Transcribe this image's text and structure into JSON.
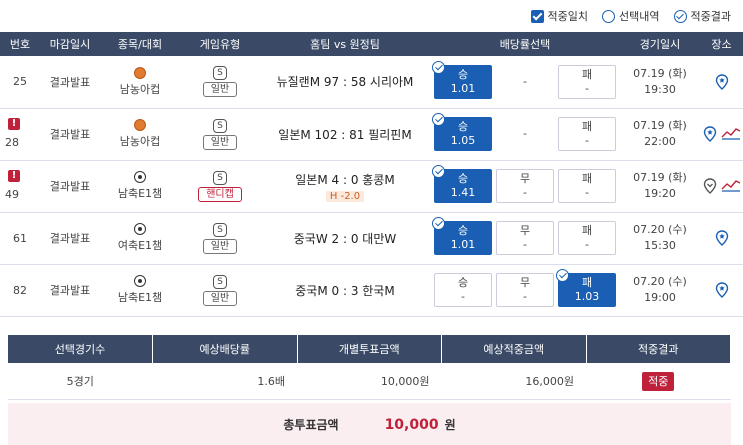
{
  "legend": [
    {
      "label": "적중일치",
      "style": "check"
    },
    {
      "label": "선택내역",
      "style": "circle-empty"
    },
    {
      "label": "적중결과",
      "style": "circle-check"
    }
  ],
  "columns": [
    "번호",
    "마감일시",
    "종목/대회",
    "게임유형",
    "홈팀 vs 원정팀",
    "배당률선택",
    "경기일시",
    "장소"
  ],
  "games": [
    {
      "no": "25",
      "warn": false,
      "close": "결과발표",
      "sport": "basket",
      "league": "남농아컵",
      "type": "일반",
      "handi": false,
      "match": "뉴질랜M 97 : 58 시리아M",
      "handi_value": "",
      "odds": [
        {
          "label": "승",
          "value": "1.01",
          "sel": true
        },
        {
          "label": "-",
          "value": "",
          "sel": false,
          "blank": true
        },
        {
          "label": "패",
          "value": "-",
          "sel": false
        }
      ],
      "date": "07.19 (화)",
      "time": "19:30",
      "chart": false
    },
    {
      "no": "28",
      "warn": true,
      "close": "결과발표",
      "sport": "basket",
      "league": "남농아컵",
      "type": "일반",
      "handi": false,
      "match": "일본M 102 : 81 필리핀M",
      "handi_value": "",
      "odds": [
        {
          "label": "승",
          "value": "1.05",
          "sel": true
        },
        {
          "label": "-",
          "value": "",
          "sel": false,
          "blank": true
        },
        {
          "label": "패",
          "value": "-",
          "sel": false
        }
      ],
      "date": "07.19 (화)",
      "time": "22:00",
      "chart": true
    },
    {
      "no": "49",
      "warn": true,
      "close": "결과발표",
      "sport": "soccer",
      "league": "남축E1챔",
      "type": "핸디캡",
      "handi": true,
      "match": "일본M 4 : 0 홍콩M",
      "handi_value": "H -2.0",
      "odds": [
        {
          "label": "승",
          "value": "1.41",
          "sel": true
        },
        {
          "label": "무",
          "value": "-",
          "sel": false
        },
        {
          "label": "패",
          "value": "-",
          "sel": false
        }
      ],
      "date": "07.19 (화)",
      "time": "19:20",
      "chart": true
    },
    {
      "no": "61",
      "warn": false,
      "close": "결과발표",
      "sport": "soccer",
      "league": "여축E1챔",
      "type": "일반",
      "handi": false,
      "match": "중국W 2 : 0 대만W",
      "handi_value": "",
      "odds": [
        {
          "label": "승",
          "value": "1.01",
          "sel": true
        },
        {
          "label": "무",
          "value": "-",
          "sel": false
        },
        {
          "label": "패",
          "value": "-",
          "sel": false
        }
      ],
      "date": "07.20 (수)",
      "time": "15:30",
      "chart": false
    },
    {
      "no": "82",
      "warn": false,
      "close": "결과발표",
      "sport": "soccer",
      "league": "남축E1챔",
      "type": "일반",
      "handi": false,
      "match": "중국M 0 : 3 한국M",
      "handi_value": "",
      "odds": [
        {
          "label": "승",
          "value": "-",
          "sel": false
        },
        {
          "label": "무",
          "value": "-",
          "sel": false
        },
        {
          "label": "패",
          "value": "1.03",
          "sel": true
        }
      ],
      "date": "07.20 (수)",
      "time": "19:00",
      "chart": false
    }
  ],
  "summary": {
    "headers": [
      "선택경기수",
      "예상배당률",
      "개별투표금액",
      "예상적중금액",
      "적중결과"
    ],
    "count": "5경기",
    "odds": "1.6배",
    "stake": "10,000원",
    "expected": "16,000원",
    "result": "적중"
  },
  "total": {
    "label": "총투표금액",
    "amount": "10,000",
    "unit": "원"
  },
  "colors": {
    "header_bg": "#3a4a66",
    "selected": "#1a5fb4",
    "accent": "#c0213a"
  }
}
